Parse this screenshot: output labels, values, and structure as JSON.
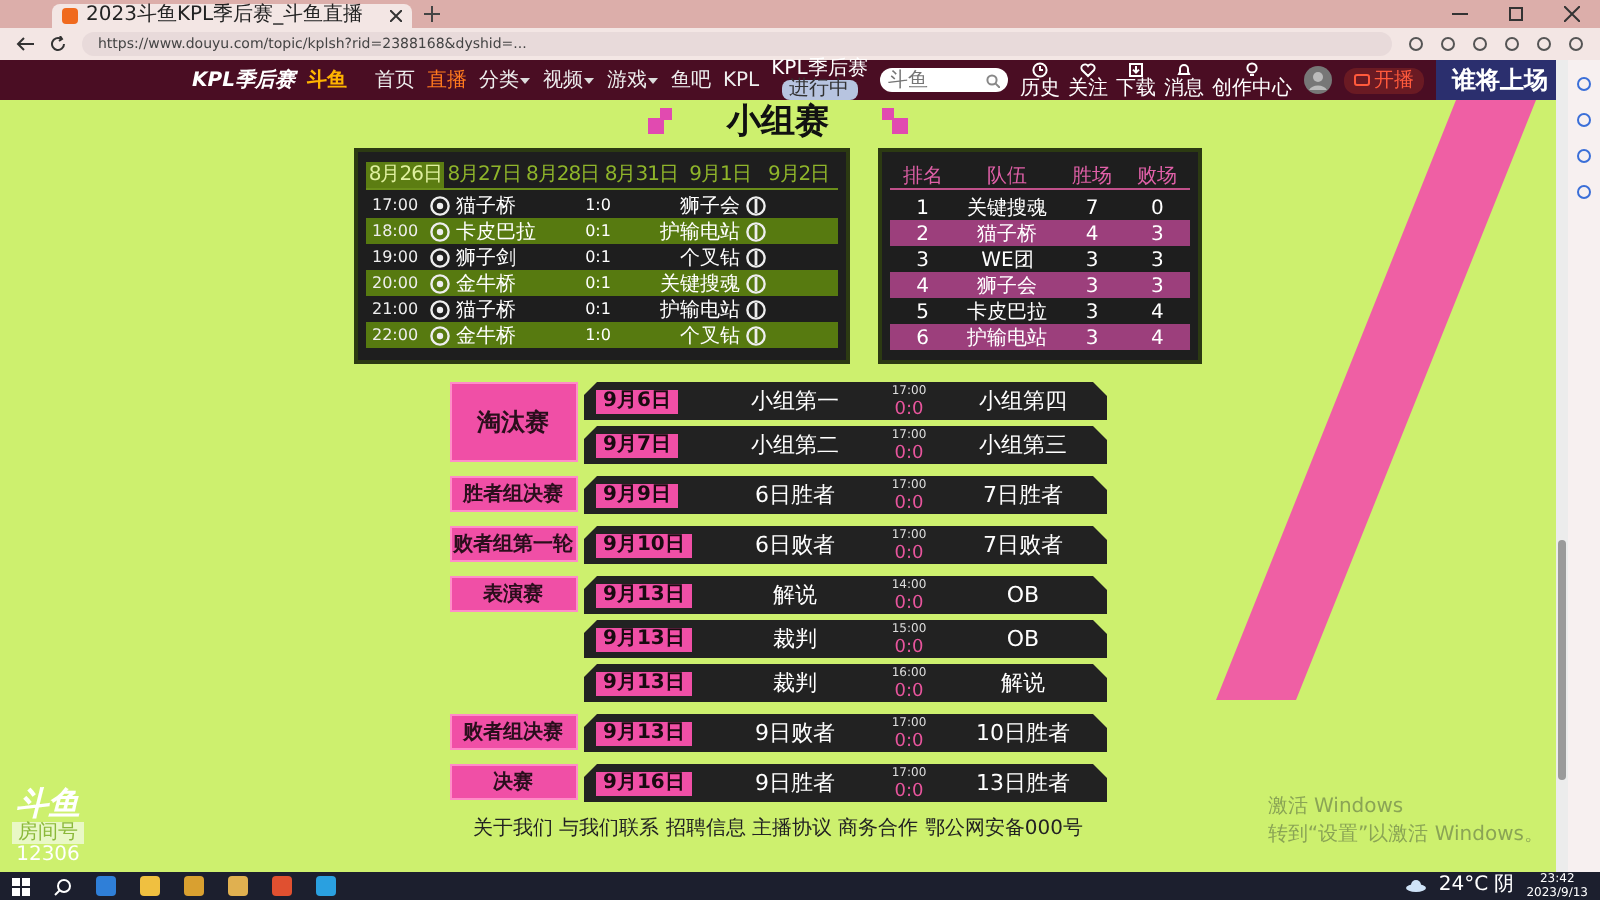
{
  "browser": {
    "tab_title": "2023斗鱼KPL季后赛_斗鱼直播",
    "url": "https://www.douyu.com/topic/kplsh?rid=2388168&dyshid=..."
  },
  "site_header": {
    "logo": "KPL季后赛",
    "brand": "斗鱼",
    "nav": [
      {
        "label": "首页",
        "selected": false,
        "dropdown": false
      },
      {
        "label": "直播",
        "selected": true,
        "dropdown": false
      },
      {
        "label": "分类",
        "selected": false,
        "dropdown": true
      },
      {
        "label": "视频",
        "selected": false,
        "dropdown": true
      },
      {
        "label": "游戏",
        "selected": false,
        "dropdown": true
      },
      {
        "label": "鱼吧",
        "selected": false,
        "dropdown": false
      },
      {
        "label": "KPL",
        "selected": false,
        "dropdown": false
      }
    ],
    "badge": {
      "title": "KPL季后赛",
      "pill": "进行中"
    },
    "search": {
      "placeholder": "斗鱼"
    },
    "actions": [
      {
        "kind": "history",
        "label": "历史"
      },
      {
        "kind": "follow",
        "label": "关注"
      },
      {
        "kind": "download",
        "label": "下载"
      },
      {
        "kind": "message",
        "label": "消息"
      },
      {
        "kind": "creator",
        "label": "创作中心"
      }
    ],
    "live_button": "开播",
    "banner": "谁将上场"
  },
  "group_stage": {
    "title": "小组赛",
    "schedule": {
      "dates": [
        {
          "label": "8月26日",
          "selected": true
        },
        {
          "label": "8月27日",
          "selected": false
        },
        {
          "label": "8月28日",
          "selected": false
        },
        {
          "label": "8月31日",
          "selected": false
        },
        {
          "label": "9月1日",
          "selected": false
        },
        {
          "label": "9月2日",
          "selected": false
        }
      ],
      "matches": [
        {
          "time": "17:00",
          "team1": "猫子桥",
          "score": "1:0",
          "team2": "狮子会"
        },
        {
          "time": "18:00",
          "team1": "卡皮巴拉",
          "score": "0:1",
          "team2": "护输电站"
        },
        {
          "time": "19:00",
          "team1": "狮子剑",
          "score": "0:1",
          "team2": "个叉钻"
        },
        {
          "time": "20:00",
          "team1": "金牛桥",
          "score": "0:1",
          "team2": "关键搜魂"
        },
        {
          "time": "21:00",
          "team1": "猫子桥",
          "score": "0:1",
          "team2": "护输电站"
        },
        {
          "time": "22:00",
          "team1": "金牛桥",
          "score": "1:0",
          "team2": "个叉钻"
        }
      ]
    },
    "standings": {
      "columns": [
        "排名",
        "队伍",
        "胜场",
        "败场"
      ],
      "rows": [
        [
          "1",
          "关键搜魂",
          "7",
          "0"
        ],
        [
          "2",
          "猫子桥",
          "4",
          "3"
        ],
        [
          "3",
          "WE团",
          "3",
          "3"
        ],
        [
          "4",
          "狮子会",
          "3",
          "3"
        ],
        [
          "5",
          "卡皮巴拉",
          "3",
          "4"
        ],
        [
          "6",
          "护输电站",
          "3",
          "4"
        ]
      ]
    }
  },
  "playoffs": [
    {
      "stage": "淘汰赛",
      "matches": [
        {
          "date": "9月6日",
          "team1": "小组第一",
          "time": "17:00",
          "score": "0:0",
          "team2": "小组第四"
        },
        {
          "date": "9月7日",
          "team1": "小组第二",
          "time": "17:00",
          "score": "0:0",
          "team2": "小组第三"
        }
      ]
    },
    {
      "stage": "胜者组决赛",
      "matches": [
        {
          "date": "9月9日",
          "team1": "6日胜者",
          "time": "17:00",
          "score": "0:0",
          "team2": "7日胜者"
        }
      ]
    },
    {
      "stage": "败者组第一轮",
      "matches": [
        {
          "date": "9月10日",
          "team1": "6日败者",
          "time": "17:00",
          "score": "0:0",
          "team2": "7日败者"
        }
      ]
    },
    {
      "stage": "表演赛",
      "matches": [
        {
          "date": "9月13日",
          "team1": "解说",
          "time": "14:00",
          "score": "0:0",
          "team2": "OB"
        },
        {
          "date": "9月13日",
          "team1": "裁判",
          "time": "15:00",
          "score": "0:0",
          "team2": "OB"
        },
        {
          "date": "9月13日",
          "team1": "裁判",
          "time": "16:00",
          "score": "0:0",
          "team2": "解说"
        }
      ]
    },
    {
      "stage": "败者组决赛",
      "matches": [
        {
          "date": "9月13日",
          "team1": "9日败者",
          "time": "17:00",
          "score": "0:0",
          "team2": "10日胜者"
        }
      ]
    },
    {
      "stage": "决赛",
      "matches": [
        {
          "date": "9月16日",
          "team1": "9日胜者",
          "time": "17:00",
          "score": "0:0",
          "team2": "13日胜者"
        }
      ]
    }
  ],
  "footer": "关于我们 与我们联系 招聘信息 主播协议 商务合作 鄂公网安备000号",
  "room": {
    "brand": "斗鱼",
    "label": "房间号",
    "number": "12306"
  },
  "windows_notice": {
    "title": "激活 Windows",
    "hint": "转到“设置”以激活 Windows。"
  },
  "taskbar": {
    "weather": "24°C 阴",
    "time": "23:42",
    "date": "2023/9/13"
  }
}
